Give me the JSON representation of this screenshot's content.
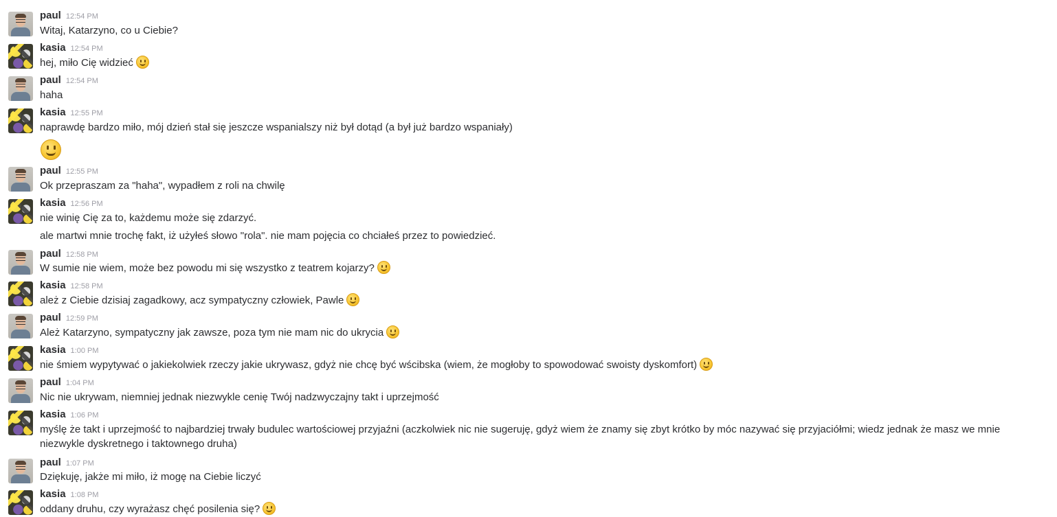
{
  "messages": [
    {
      "author": "paul",
      "time": "12:54 PM",
      "lines": [
        {
          "text": "Witaj, Katarzyno, co u Ciebie?",
          "emoji": false
        }
      ]
    },
    {
      "author": "kasia",
      "time": "12:54 PM",
      "lines": [
        {
          "text": "hej, miło Cię widzieć",
          "emoji": true
        }
      ]
    },
    {
      "author": "paul",
      "time": "12:54 PM",
      "lines": [
        {
          "text": "haha",
          "emoji": false
        }
      ]
    },
    {
      "author": "kasia",
      "time": "12:55 PM",
      "lines": [
        {
          "text": "naprawdę bardzo miło, mój dzień stał się jeszcze wspanialszy niż był dotąd (a był już bardzo wspaniały)",
          "emoji": false
        }
      ],
      "big_emoji": true
    },
    {
      "author": "paul",
      "time": "12:55 PM",
      "lines": [
        {
          "text": "Ok przepraszam za \"haha\", wypadłem z roli na chwilę",
          "emoji": false
        }
      ]
    },
    {
      "author": "kasia",
      "time": "12:56 PM",
      "lines": [
        {
          "text": "nie winię Cię za to, każdemu może się zdarzyć.",
          "emoji": false
        },
        {
          "text": "ale martwi mnie trochę fakt, iż użyłeś słowo \"rola\". nie mam pojęcia co chciałeś przez to powiedzieć.",
          "emoji": false
        }
      ]
    },
    {
      "author": "paul",
      "time": "12:58 PM",
      "lines": [
        {
          "text": "W sumie nie wiem, może bez powodu mi się wszystko z teatrem kojarzy?",
          "emoji": true
        }
      ]
    },
    {
      "author": "kasia",
      "time": "12:58 PM",
      "lines": [
        {
          "text": "ależ z Ciebie dzisiaj zagadkowy, acz sympatyczny człowiek, Pawle",
          "emoji": true
        }
      ]
    },
    {
      "author": "paul",
      "time": "12:59 PM",
      "lines": [
        {
          "text": "Ależ Katarzyno, sympatyczny jak zawsze, poza tym nie mam nic do ukrycia",
          "emoji": true
        }
      ]
    },
    {
      "author": "kasia",
      "time": "1:00 PM",
      "lines": [
        {
          "text": "nie śmiem wypytywać o jakiekolwiek rzeczy jakie ukrywasz, gdyż nie chcę być wścibska (wiem, że mogłoby to spowodować swoisty dyskomfort)",
          "emoji": true
        }
      ]
    },
    {
      "author": "paul",
      "time": "1:04 PM",
      "lines": [
        {
          "text": "Nic nie ukrywam, niemniej jednak niezwykle cenię Twój nadzwyczajny takt i uprzejmość",
          "emoji": false
        }
      ]
    },
    {
      "author": "kasia",
      "time": "1:06 PM",
      "lines": [
        {
          "text": "myślę że takt i uprzejmość to najbardziej trwały budulec wartościowej przyjaźni (aczkolwiek nic nie sugeruję, gdyż wiem że znamy się zbyt krótko by móc nazywać się przyjaciółmi; wiedz jednak że masz we mnie niezwykle dyskretnego i taktownego druha)",
          "emoji": false
        }
      ]
    },
    {
      "author": "paul",
      "time": "1:07 PM",
      "lines": [
        {
          "text": "Dziękuję, jakże mi miło, iż mogę na Ciebie liczyć",
          "emoji": false
        }
      ]
    },
    {
      "author": "kasia",
      "time": "1:08 PM",
      "lines": [
        {
          "text": "oddany druhu, czy wyrażasz chęć posilenia się?",
          "emoji": true
        }
      ]
    }
  ]
}
